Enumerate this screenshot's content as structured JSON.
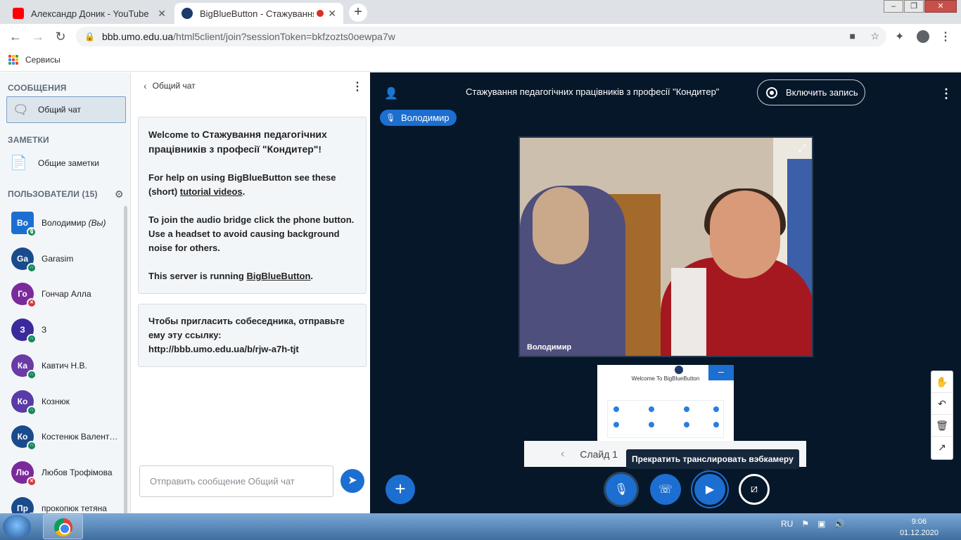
{
  "browser": {
    "tabs": [
      {
        "title": "Александр Доник - YouTube",
        "favicon_color": "#ff0000"
      },
      {
        "title": "BigBlueButton - Стажування",
        "favicon_color": "#1c3a6a"
      }
    ],
    "url_host": "bbb.umo.edu.ua",
    "url_path": "/html5client/join?sessionToken=bkfzozts0oewpa7w",
    "bookmark_apps_label": "Сервисы"
  },
  "sidebar": {
    "messages_header": "СООБЩЕНИЯ",
    "public_chat": "Общий чат",
    "notes_header": "ЗАМЕТКИ",
    "shared_notes": "Общие заметки",
    "users_header": "ПОЛЬЗОВАТЕЛИ (15)",
    "users": [
      {
        "initials": "Во",
        "name": "Володимир",
        "suffix": "(Вы)",
        "color": "#1c6fd1",
        "status": "mic",
        "status_color": "#12885a"
      },
      {
        "initials": "Ga",
        "name": "Garasim",
        "color": "#1a4b8c",
        "status": "listen",
        "status_color": "#12885a"
      },
      {
        "initials": "Го",
        "name": "Гончар Алла",
        "color": "#7b2a9c",
        "status": "muted",
        "status_color": "#d13b3b"
      },
      {
        "initials": "З",
        "name": "З",
        "color": "#3a2a9c",
        "status": "listen",
        "status_color": "#12885a"
      },
      {
        "initials": "Ка",
        "name": "Кавтич Н.В.",
        "color": "#6a3aa6",
        "status": "listen",
        "status_color": "#12885a"
      },
      {
        "initials": "Ко",
        "name": "Кознюк",
        "color": "#5a3aa6",
        "status": "listen",
        "status_color": "#12885a"
      },
      {
        "initials": "Ко",
        "name": "Костенюк Валент…",
        "color": "#1a4b8c",
        "status": "listen",
        "status_color": "#12885a"
      },
      {
        "initials": "Лю",
        "name": "Любов Трофімова",
        "color": "#7b2a9c",
        "status": "muted",
        "status_color": "#d13b3b"
      },
      {
        "initials": "Пр",
        "name": "прокопюк тетяна",
        "color": "#1a4b8c",
        "status": "listen",
        "status_color": "#12885a"
      }
    ]
  },
  "chat": {
    "title": "Общий чат",
    "welcome_prefix": "Welcome to ",
    "welcome_name": "Стажування педагогічних працівників з професії \"Кондитер\"",
    "welcome_suffix": "!",
    "help_prefix": "For help on using BigBlueButton see these (short) ",
    "help_link": "tutorial videos",
    "help_suffix": ".",
    "audio_text": "To join the audio bridge click the phone button. Use a headset to avoid causing background noise for others.",
    "server_prefix": "This server is running ",
    "server_link": "BigBlueButton",
    "server_suffix": ".",
    "invite_text": "Чтобы пригласить собеседника, отправьте ему эту ссылку:",
    "invite_link": "http://bbb.umo.edu.ua/b/rjw-a7h-tjt",
    "input_placeholder": "Отправить сообщение Общий чат"
  },
  "meeting": {
    "title": "Стажування педагогічних працівників з професії \"Кондитер\"",
    "record_label": "Включить запись",
    "talking_user": "Володимир",
    "video_label": "Володимир",
    "slide_title": "Welcome To BigBlueButton",
    "slide_label": "Слайд 1",
    "tooltip": "Прекратить транслировать вэбкамеру"
  },
  "taskbar": {
    "lang": "RU",
    "time": "9:06",
    "date": "01.12.2020"
  }
}
